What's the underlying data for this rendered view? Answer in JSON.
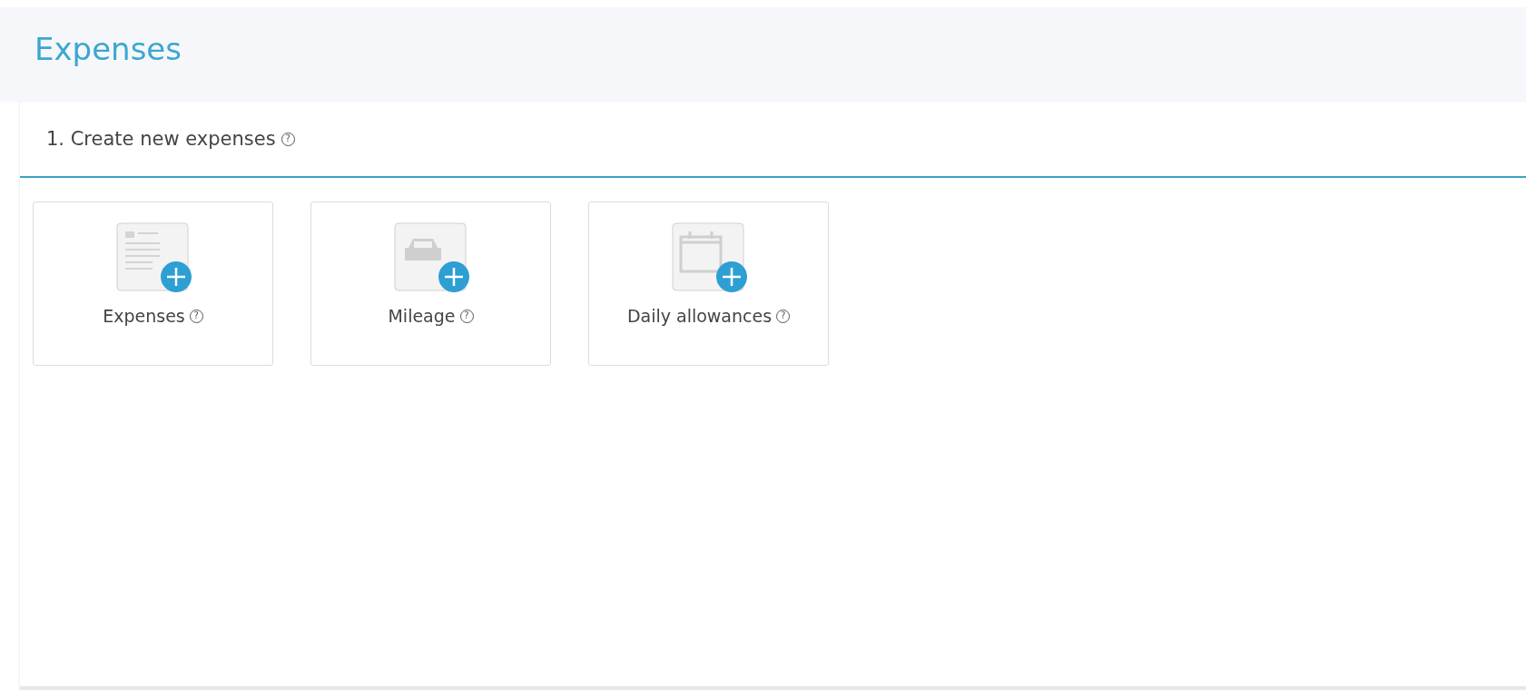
{
  "page": {
    "title": "Expenses"
  },
  "section": {
    "title": "1. Create new expenses",
    "help": "?"
  },
  "cards": [
    {
      "kind": "document",
      "label": "Expenses",
      "help": "?"
    },
    {
      "kind": "car",
      "label": "Mileage",
      "help": "?"
    },
    {
      "kind": "calendar",
      "label": "Daily allowances",
      "help": "?"
    }
  ]
}
